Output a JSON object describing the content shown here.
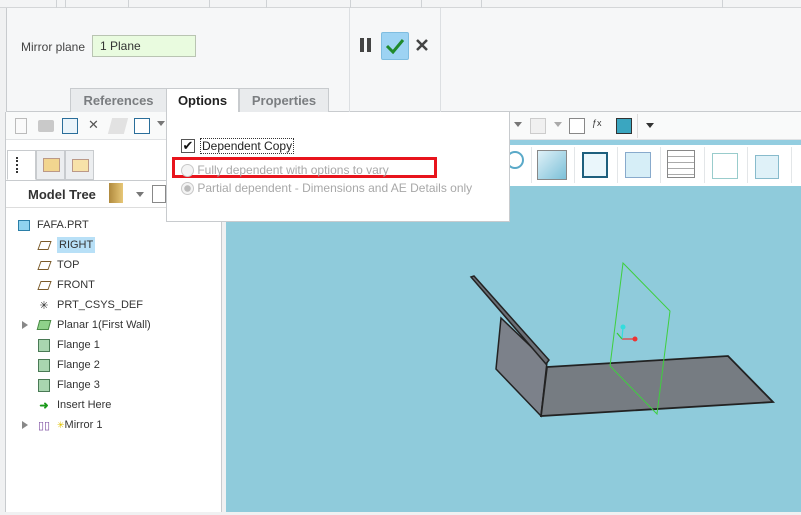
{
  "dashboard": {
    "mirror_plane_label": "Mirror plane",
    "mirror_plane_value": "1 Plane",
    "tabs": [
      {
        "label": "References",
        "active": false
      },
      {
        "label": "Options",
        "active": true
      },
      {
        "label": "Properties",
        "active": false
      }
    ]
  },
  "options_panel": {
    "dependent_copy_label": "Dependent Copy",
    "dependent_copy_checked": true,
    "option_fully": "Fully dependent with options to vary",
    "option_partial": "Partial dependent - Dimensions and AE Details only",
    "selected_option": "partial",
    "highlight_color": "#e8141c"
  },
  "model_tree": {
    "title": "Model Tree",
    "items": [
      {
        "label": "FAFA.PRT",
        "icon": "part-icon"
      },
      {
        "label": "RIGHT",
        "icon": "datum-plane-icon",
        "selected": true
      },
      {
        "label": "TOP",
        "icon": "datum-plane-icon"
      },
      {
        "label": "FRONT",
        "icon": "datum-plane-icon"
      },
      {
        "label": "PRT_CSYS_DEF",
        "icon": "csys-icon"
      },
      {
        "label": "Planar 1(First Wall)",
        "icon": "planar-wall-icon",
        "expandable": true
      },
      {
        "label": "Flange 1",
        "icon": "flange-icon"
      },
      {
        "label": "Flange 2",
        "icon": "flange-icon"
      },
      {
        "label": "Flange 3",
        "icon": "flange-icon"
      },
      {
        "label": "Insert Here",
        "icon": "insert-arrow-icon"
      },
      {
        "label": "Mirror 1",
        "icon": "mirror-icon",
        "expandable": true
      }
    ]
  },
  "colors": {
    "viewport": "#8fcbdb",
    "field_bg": "#e9fbdf",
    "selected": "#b8e0f7",
    "ok_button": "#9dd3f3"
  }
}
